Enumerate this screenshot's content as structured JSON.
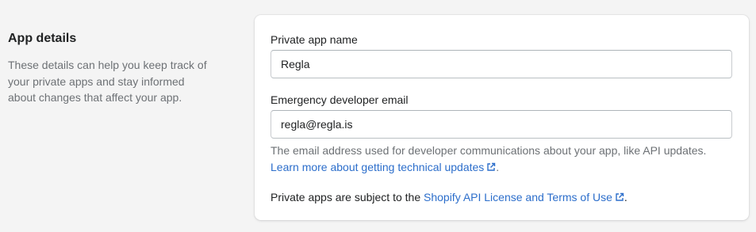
{
  "section": {
    "title": "App details",
    "description": "These details can help you keep track of your private apps and stay informed about changes that affect your app."
  },
  "form": {
    "app_name": {
      "label": "Private app name",
      "value": "Regla"
    },
    "dev_email": {
      "label": "Emergency developer email",
      "value": "regla@regla.is",
      "help_prefix": "The email address used for developer communications about your app, like API updates. ",
      "help_link": "Learn more about getting technical updates",
      "help_suffix": "."
    }
  },
  "terms": {
    "prefix": "Private apps are subject to the ",
    "link": "Shopify API License and Terms of Use",
    "suffix": "."
  },
  "colors": {
    "link": "#2c6ecb",
    "subdued_text": "#6d7175",
    "page_background": "#f4f4f4"
  },
  "icons": {
    "external_link": "external-link-icon"
  }
}
